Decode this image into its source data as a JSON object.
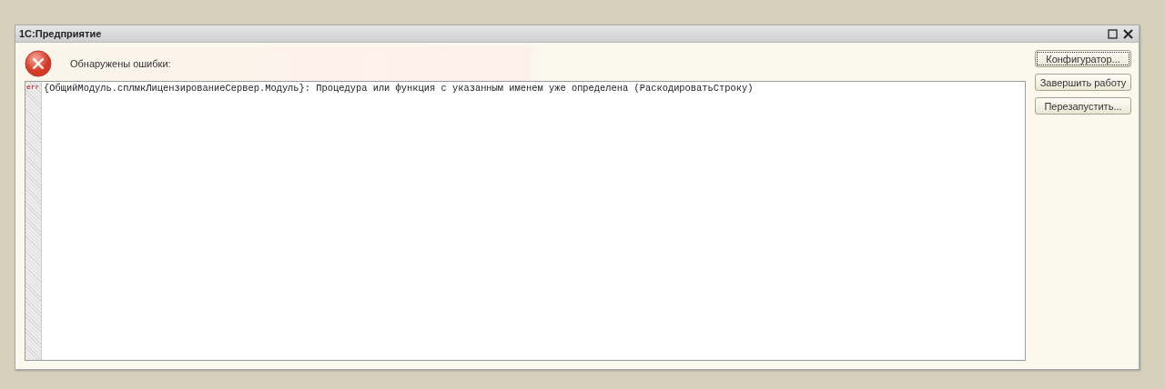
{
  "window": {
    "title": "1С:Предприятие"
  },
  "header": {
    "message": "Обнаружены ошибки:"
  },
  "errors": [
    {
      "marker": "err",
      "text": "{ОбщийМодуль.сплмкЛицензированиеСервер.Модуль}: Процедура или функция с указанным именем уже определена (РаскодироватьСтроку)"
    }
  ],
  "buttons": [
    {
      "label": "Конфигуратор...",
      "focused": true
    },
    {
      "label": "Завершить работу",
      "focused": false
    },
    {
      "label": "Перезапустить...",
      "focused": false
    }
  ]
}
